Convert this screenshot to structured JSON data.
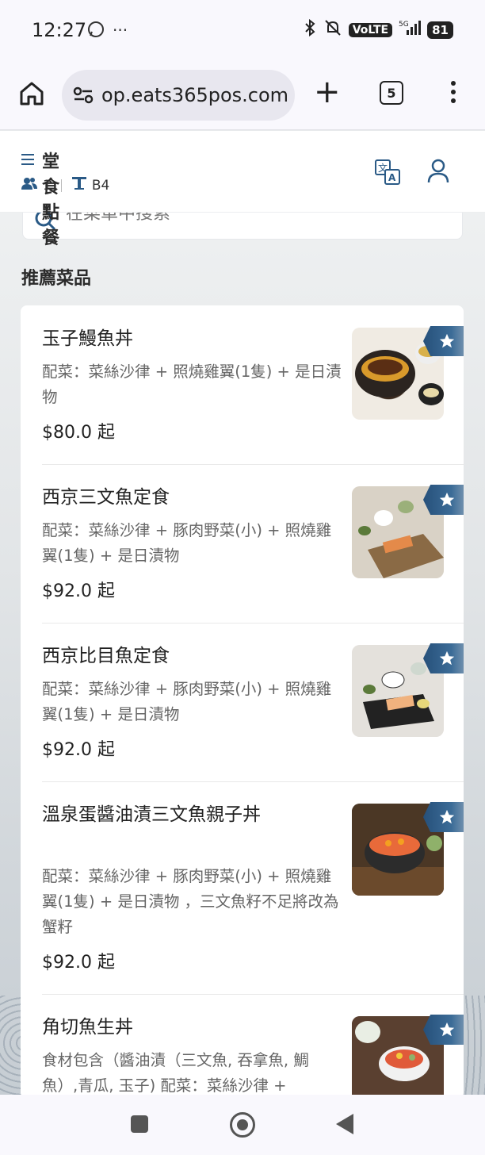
{
  "status_bar": {
    "time": "12:27",
    "battery": "81",
    "network": "5G",
    "volte": "VoLTE"
  },
  "browser": {
    "url": "op.eats365pos.com",
    "tab_count": "5"
  },
  "header": {
    "title": "堂食點餐",
    "guests": "1",
    "table": "B4"
  },
  "search": {
    "placeholder": "在菜單中搜索"
  },
  "section": {
    "title": "推薦菜品"
  },
  "menu_items": [
    {
      "name": "玉子鰻魚丼",
      "desc": "配菜：菜絲沙律 + 照燒雞翼(1隻) + 是日漬物",
      "price": "$80.0 起"
    },
    {
      "name": "西京三文魚定食",
      "desc": "配菜：菜絲沙律 + 豚肉野菜(小) + 照燒雞翼(1隻) + 是日漬物",
      "price": "$92.0 起"
    },
    {
      "name": "西京比目魚定食",
      "desc": "配菜：菜絲沙律 + 豚肉野菜(小) + 照燒雞翼(1隻) + 是日漬物",
      "price": "$92.0 起"
    },
    {
      "name": "溫泉蛋醬油漬三文魚親子丼",
      "desc": "配菜：菜絲沙律 + 豚肉野菜(小) + 照燒雞翼(1隻) + 是日漬物 ，三文魚籽不足將改為蟹籽",
      "price": "$92.0 起"
    },
    {
      "name": "角切魚生丼",
      "desc": "食材包含（醬油漬（三文魚, 吞拿魚, 鯛魚）,青瓜, 玉子) 配菜：菜絲沙律 +",
      "price": ""
    }
  ]
}
